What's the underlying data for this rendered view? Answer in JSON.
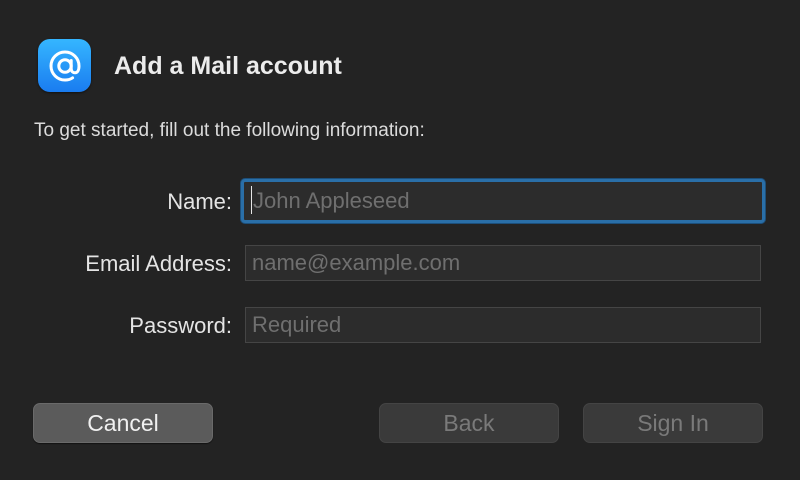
{
  "dialog": {
    "title": "Add a Mail account",
    "icon": "at-sign-icon",
    "accent_color": "#1a7cf0",
    "intro": "To get started, fill out the following information:"
  },
  "form": {
    "name": {
      "label": "Name:",
      "value": "",
      "placeholder": "John Appleseed",
      "focused": true
    },
    "email": {
      "label": "Email Address:",
      "value": "",
      "placeholder": "name@example.com"
    },
    "password": {
      "label": "Password:",
      "value": "",
      "placeholder": "Required"
    }
  },
  "buttons": {
    "cancel": "Cancel",
    "back": "Back",
    "sign_in": "Sign In"
  }
}
